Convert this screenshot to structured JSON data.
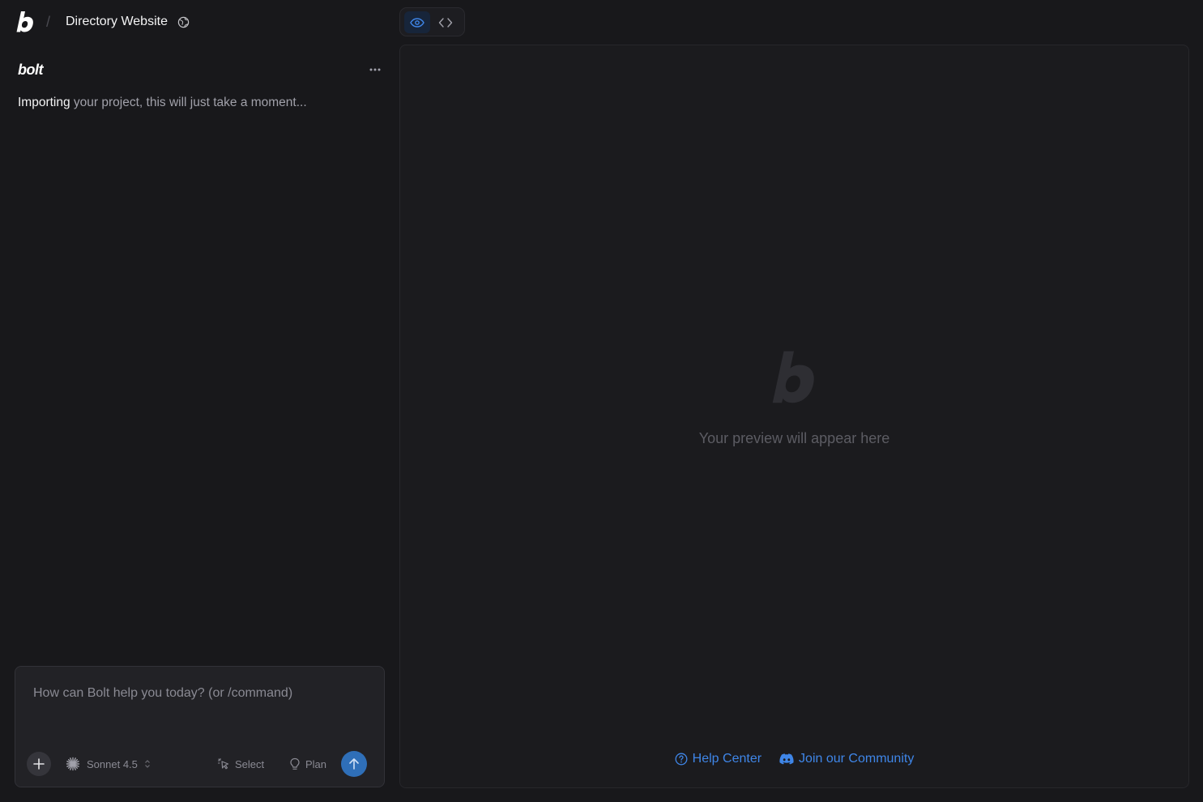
{
  "header": {
    "separator": "/",
    "project_title": "Directory Website",
    "visibility_icon": "globe-icon"
  },
  "chat": {
    "brand": "bolt",
    "status": {
      "highlight": "Importing",
      "rest": " your project, this will just take a moment..."
    },
    "composer": {
      "placeholder": "How can Bolt help you today? (or /command)",
      "value": "",
      "model": "Sonnet 4.5",
      "select_label": "Select",
      "plan_label": "Plan"
    }
  },
  "workbench": {
    "toggle": [
      "preview-eye-icon",
      "code-brackets-icon"
    ],
    "active_view": "preview",
    "preview_message": "Your preview will appear here",
    "links": [
      {
        "label": "Help Center",
        "icon": "help-circle-icon"
      },
      {
        "label": "Join our Community",
        "icon": "discord-icon"
      }
    ]
  },
  "colors": {
    "background": "#18181b",
    "accent": "#3f86e8",
    "send_button": "#2f6fb8"
  }
}
